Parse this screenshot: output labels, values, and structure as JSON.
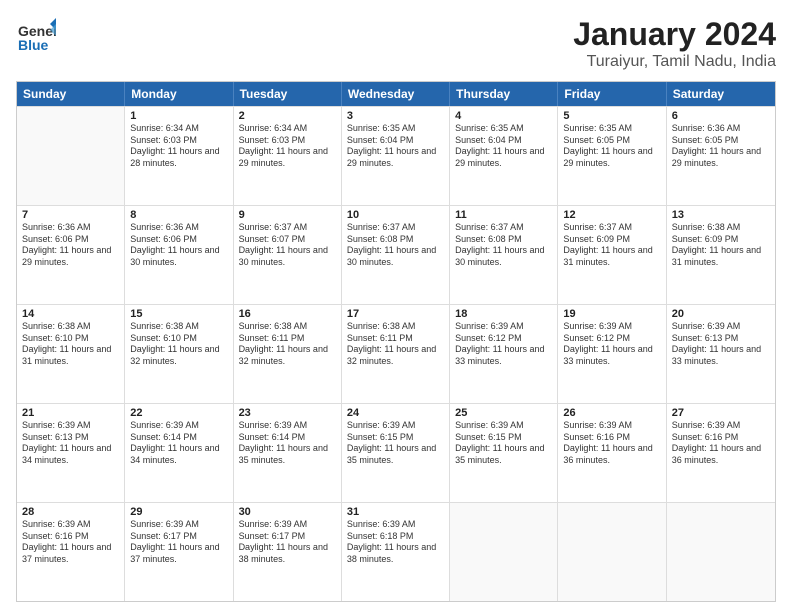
{
  "header": {
    "logo_general": "General",
    "logo_blue": "Blue",
    "main_title": "January 2024",
    "subtitle": "Turaiyur, Tamil Nadu, India"
  },
  "calendar": {
    "days_of_week": [
      "Sunday",
      "Monday",
      "Tuesday",
      "Wednesday",
      "Thursday",
      "Friday",
      "Saturday"
    ],
    "weeks": [
      [
        {
          "day": "",
          "empty": true
        },
        {
          "day": "1",
          "sunrise": "Sunrise: 6:34 AM",
          "sunset": "Sunset: 6:03 PM",
          "daylight": "Daylight: 11 hours and 28 minutes."
        },
        {
          "day": "2",
          "sunrise": "Sunrise: 6:34 AM",
          "sunset": "Sunset: 6:03 PM",
          "daylight": "Daylight: 11 hours and 29 minutes."
        },
        {
          "day": "3",
          "sunrise": "Sunrise: 6:35 AM",
          "sunset": "Sunset: 6:04 PM",
          "daylight": "Daylight: 11 hours and 29 minutes."
        },
        {
          "day": "4",
          "sunrise": "Sunrise: 6:35 AM",
          "sunset": "Sunset: 6:04 PM",
          "daylight": "Daylight: 11 hours and 29 minutes."
        },
        {
          "day": "5",
          "sunrise": "Sunrise: 6:35 AM",
          "sunset": "Sunset: 6:05 PM",
          "daylight": "Daylight: 11 hours and 29 minutes."
        },
        {
          "day": "6",
          "sunrise": "Sunrise: 6:36 AM",
          "sunset": "Sunset: 6:05 PM",
          "daylight": "Daylight: 11 hours and 29 minutes."
        }
      ],
      [
        {
          "day": "7",
          "sunrise": "Sunrise: 6:36 AM",
          "sunset": "Sunset: 6:06 PM",
          "daylight": "Daylight: 11 hours and 29 minutes."
        },
        {
          "day": "8",
          "sunrise": "Sunrise: 6:36 AM",
          "sunset": "Sunset: 6:06 PM",
          "daylight": "Daylight: 11 hours and 30 minutes."
        },
        {
          "day": "9",
          "sunrise": "Sunrise: 6:37 AM",
          "sunset": "Sunset: 6:07 PM",
          "daylight": "Daylight: 11 hours and 30 minutes."
        },
        {
          "day": "10",
          "sunrise": "Sunrise: 6:37 AM",
          "sunset": "Sunset: 6:08 PM",
          "daylight": "Daylight: 11 hours and 30 minutes."
        },
        {
          "day": "11",
          "sunrise": "Sunrise: 6:37 AM",
          "sunset": "Sunset: 6:08 PM",
          "daylight": "Daylight: 11 hours and 30 minutes."
        },
        {
          "day": "12",
          "sunrise": "Sunrise: 6:37 AM",
          "sunset": "Sunset: 6:09 PM",
          "daylight": "Daylight: 11 hours and 31 minutes."
        },
        {
          "day": "13",
          "sunrise": "Sunrise: 6:38 AM",
          "sunset": "Sunset: 6:09 PM",
          "daylight": "Daylight: 11 hours and 31 minutes."
        }
      ],
      [
        {
          "day": "14",
          "sunrise": "Sunrise: 6:38 AM",
          "sunset": "Sunset: 6:10 PM",
          "daylight": "Daylight: 11 hours and 31 minutes."
        },
        {
          "day": "15",
          "sunrise": "Sunrise: 6:38 AM",
          "sunset": "Sunset: 6:10 PM",
          "daylight": "Daylight: 11 hours and 32 minutes."
        },
        {
          "day": "16",
          "sunrise": "Sunrise: 6:38 AM",
          "sunset": "Sunset: 6:11 PM",
          "daylight": "Daylight: 11 hours and 32 minutes."
        },
        {
          "day": "17",
          "sunrise": "Sunrise: 6:38 AM",
          "sunset": "Sunset: 6:11 PM",
          "daylight": "Daylight: 11 hours and 32 minutes."
        },
        {
          "day": "18",
          "sunrise": "Sunrise: 6:39 AM",
          "sunset": "Sunset: 6:12 PM",
          "daylight": "Daylight: 11 hours and 33 minutes."
        },
        {
          "day": "19",
          "sunrise": "Sunrise: 6:39 AM",
          "sunset": "Sunset: 6:12 PM",
          "daylight": "Daylight: 11 hours and 33 minutes."
        },
        {
          "day": "20",
          "sunrise": "Sunrise: 6:39 AM",
          "sunset": "Sunset: 6:13 PM",
          "daylight": "Daylight: 11 hours and 33 minutes."
        }
      ],
      [
        {
          "day": "21",
          "sunrise": "Sunrise: 6:39 AM",
          "sunset": "Sunset: 6:13 PM",
          "daylight": "Daylight: 11 hours and 34 minutes."
        },
        {
          "day": "22",
          "sunrise": "Sunrise: 6:39 AM",
          "sunset": "Sunset: 6:14 PM",
          "daylight": "Daylight: 11 hours and 34 minutes."
        },
        {
          "day": "23",
          "sunrise": "Sunrise: 6:39 AM",
          "sunset": "Sunset: 6:14 PM",
          "daylight": "Daylight: 11 hours and 35 minutes."
        },
        {
          "day": "24",
          "sunrise": "Sunrise: 6:39 AM",
          "sunset": "Sunset: 6:15 PM",
          "daylight": "Daylight: 11 hours and 35 minutes."
        },
        {
          "day": "25",
          "sunrise": "Sunrise: 6:39 AM",
          "sunset": "Sunset: 6:15 PM",
          "daylight": "Daylight: 11 hours and 35 minutes."
        },
        {
          "day": "26",
          "sunrise": "Sunrise: 6:39 AM",
          "sunset": "Sunset: 6:16 PM",
          "daylight": "Daylight: 11 hours and 36 minutes."
        },
        {
          "day": "27",
          "sunrise": "Sunrise: 6:39 AM",
          "sunset": "Sunset: 6:16 PM",
          "daylight": "Daylight: 11 hours and 36 minutes."
        }
      ],
      [
        {
          "day": "28",
          "sunrise": "Sunrise: 6:39 AM",
          "sunset": "Sunset: 6:16 PM",
          "daylight": "Daylight: 11 hours and 37 minutes."
        },
        {
          "day": "29",
          "sunrise": "Sunrise: 6:39 AM",
          "sunset": "Sunset: 6:17 PM",
          "daylight": "Daylight: 11 hours and 37 minutes."
        },
        {
          "day": "30",
          "sunrise": "Sunrise: 6:39 AM",
          "sunset": "Sunset: 6:17 PM",
          "daylight": "Daylight: 11 hours and 38 minutes."
        },
        {
          "day": "31",
          "sunrise": "Sunrise: 6:39 AM",
          "sunset": "Sunset: 6:18 PM",
          "daylight": "Daylight: 11 hours and 38 minutes."
        },
        {
          "day": "",
          "empty": true
        },
        {
          "day": "",
          "empty": true
        },
        {
          "day": "",
          "empty": true
        }
      ]
    ]
  }
}
